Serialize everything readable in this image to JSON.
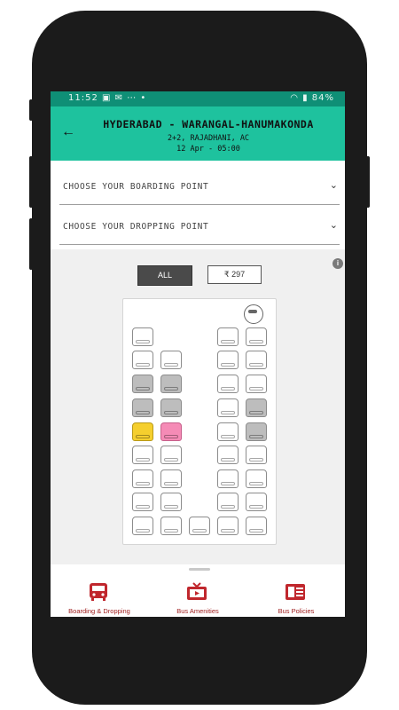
{
  "status_bar": {
    "time": "11:52",
    "left_icons": "▣ ✉ ⋯ •",
    "right_icons": "◠ ▮ 84%"
  },
  "header": {
    "back_icon": "back-arrow-icon",
    "route": "HYDERABAD - WARANGAL-HANUMAKONDA",
    "bus_type": "2+2, RAJADHANI, AC",
    "date_time": "12 Apr - 05:00"
  },
  "boarding": {
    "label": "CHOOSE YOUR BOARDING POINT"
  },
  "dropping": {
    "label": "CHOOSE YOUR DROPPING POINT"
  },
  "filters": {
    "all": "ALL",
    "price": "₹ 297"
  },
  "seat_legend_colors": {
    "available": "#ffffff",
    "booked": "#bdbdbd",
    "ladies": "#f58bb6",
    "selected": "#f5cf2e"
  },
  "seat_rows": [
    [
      "available",
      "",
      "",
      "available",
      "available"
    ],
    [
      "available",
      "available",
      "",
      "available",
      "available"
    ],
    [
      "booked",
      "booked",
      "",
      "available",
      "available"
    ],
    [
      "booked",
      "booked",
      "",
      "available",
      "booked"
    ],
    [
      "yellow",
      "pink",
      "",
      "available",
      "booked"
    ],
    [
      "available",
      "available",
      "",
      "available",
      "available"
    ],
    [
      "available",
      "available",
      "",
      "available",
      "available"
    ],
    [
      "available",
      "available",
      "",
      "available",
      "available"
    ],
    [
      "available",
      "available",
      "available",
      "available",
      "available"
    ]
  ],
  "bottom_nav": [
    {
      "label": "Boarding & Dropping",
      "icon": "bus-icon"
    },
    {
      "label": "Bus Amenities",
      "icon": "tv-icon"
    },
    {
      "label": "Bus Policies",
      "icon": "document-icon"
    }
  ],
  "colors": {
    "header": "#1ec29e",
    "status_bar": "#0f8f76",
    "nav_accent": "#c0272d"
  }
}
